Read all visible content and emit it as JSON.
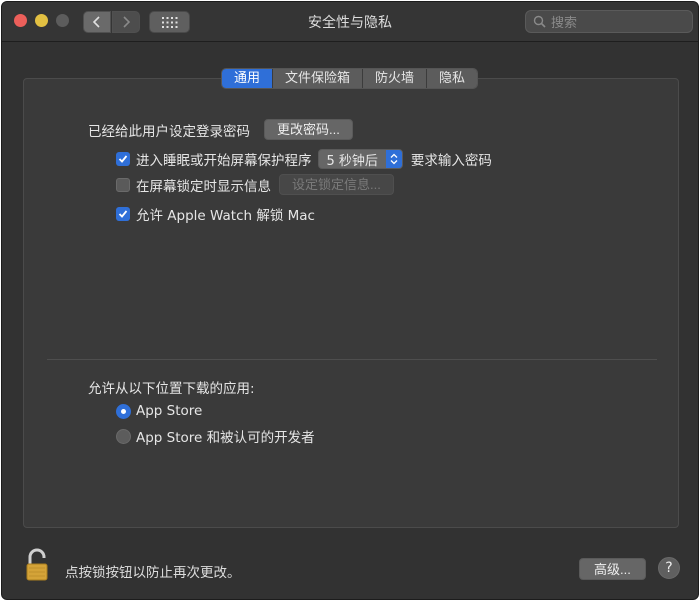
{
  "window": {
    "title": "安全性与隐私",
    "search_placeholder": "搜索"
  },
  "tabs": [
    {
      "label": "通用",
      "active": true
    },
    {
      "label": "文件保险箱",
      "active": false
    },
    {
      "label": "防火墙",
      "active": false
    },
    {
      "label": "隐私",
      "active": false
    }
  ],
  "general": {
    "password_label": "已经给此用户设定登录密码",
    "change_password_button": "更改密码...",
    "require_password": {
      "checked": true,
      "label": "进入睡眠或开始屏幕保护程序",
      "delay_value": "5 秒钟后",
      "suffix": "要求输入密码"
    },
    "lock_message": {
      "checked": false,
      "label": "在屏幕锁定时显示信息",
      "button": "设定锁定信息..."
    },
    "apple_watch": {
      "checked": true,
      "label": "允许 Apple Watch 解锁 Mac"
    },
    "downloads": {
      "label": "允许从以下位置下载的应用:",
      "options": [
        {
          "label": "App Store",
          "selected": true
        },
        {
          "label": "App Store 和被认可的开发者",
          "selected": false
        }
      ]
    }
  },
  "footer": {
    "lock_text": "点按锁按钮以防止再次更改。",
    "advanced_button": "高级...",
    "help_glyph": "?"
  },
  "colors": {
    "accent": "#2f6fd8",
    "window_bg": "#323232",
    "panel_bg": "#3a3a3a"
  }
}
